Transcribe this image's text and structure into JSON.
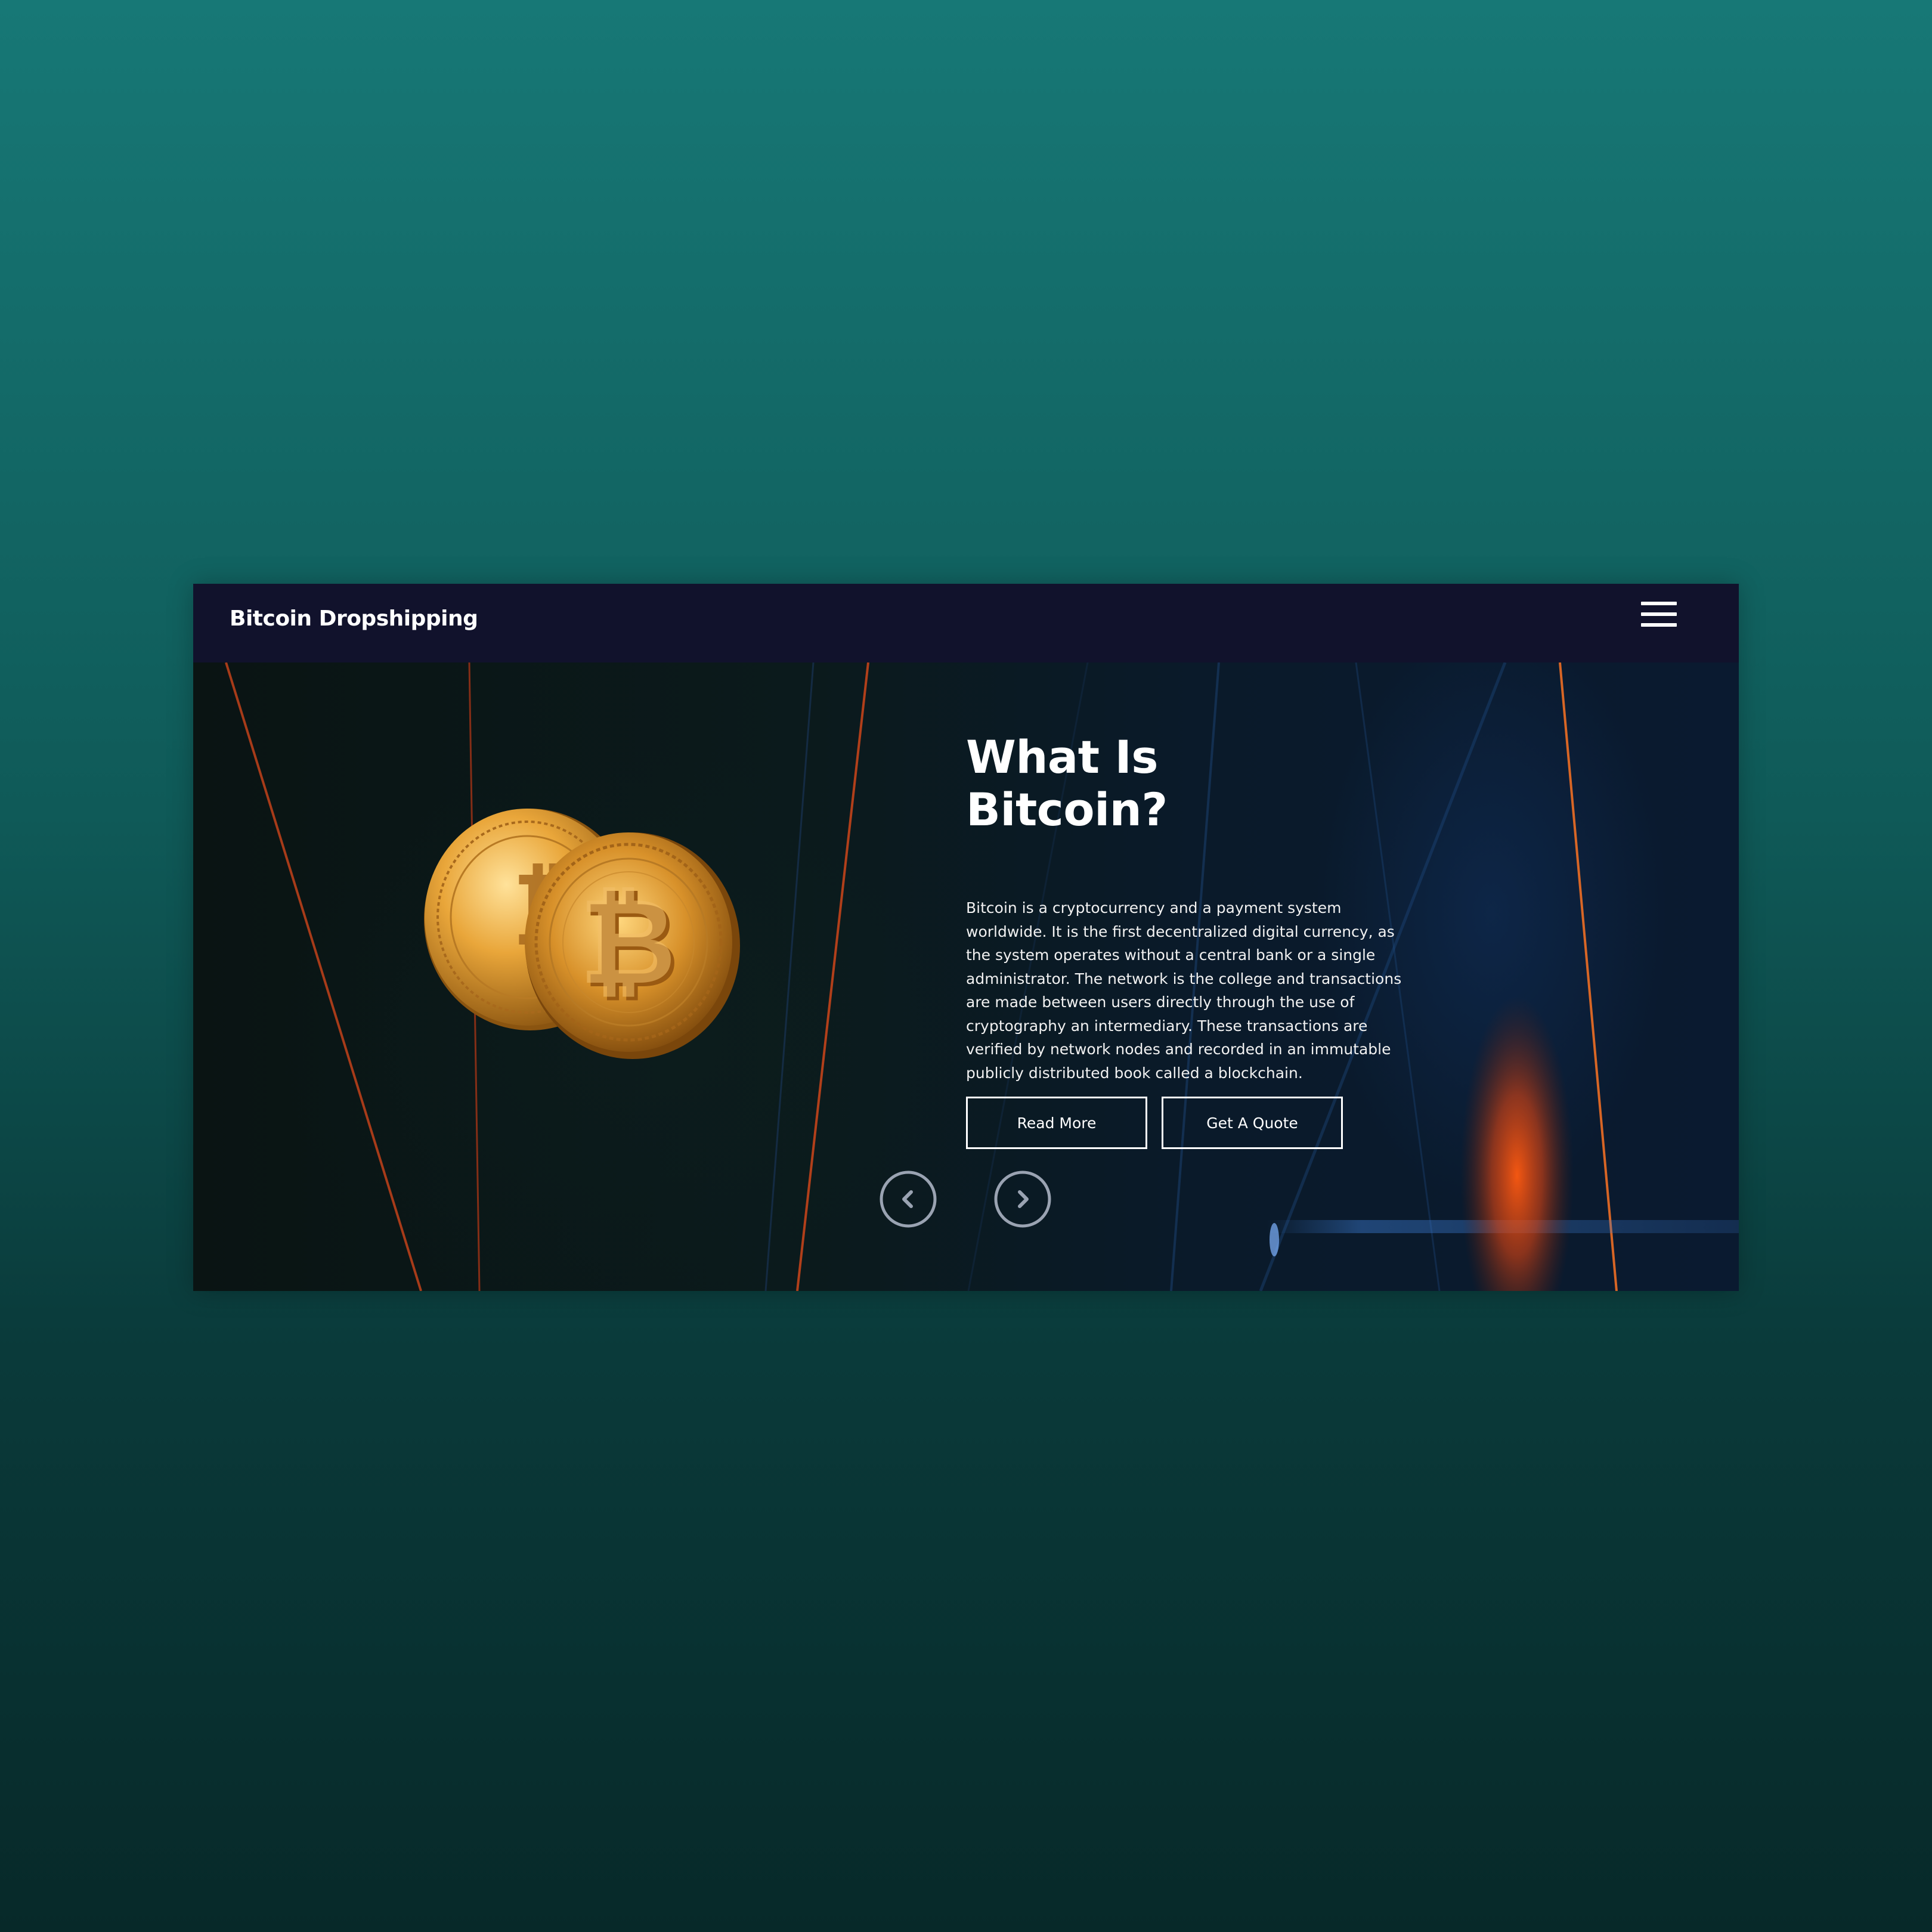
{
  "navbar": {
    "brand": "Bitcoin Dropshipping",
    "menu_icon": "hamburger-menu-icon"
  },
  "hero": {
    "title_line1": "What Is",
    "title_line2": "Bitcoin?",
    "body": "Bitcoin is a cryptocurrency and a payment system worldwide. It is the first decentralized digital currency, as the system operates without a central bank or a single administrator. The network is the college and transactions are made between users directly through the use of cryptography an intermediary. These transactions are verified by network nodes and recorded in an immutable publicly distributed book called a blockchain.",
    "image": "bitcoin-coins-image",
    "buttons": {
      "read_more": "Read More",
      "get_quote": "Get A Quote"
    },
    "carousel": {
      "prev_icon": "chevron-left-circle-icon",
      "next_icon": "chevron-right-circle-icon"
    }
  },
  "colors": {
    "page_bg_top": "#177876",
    "page_bg_bottom": "#072929",
    "navbar_bg": "#11122c",
    "coin_gold": "#e9a63a",
    "accent_line": "#e0571c"
  }
}
